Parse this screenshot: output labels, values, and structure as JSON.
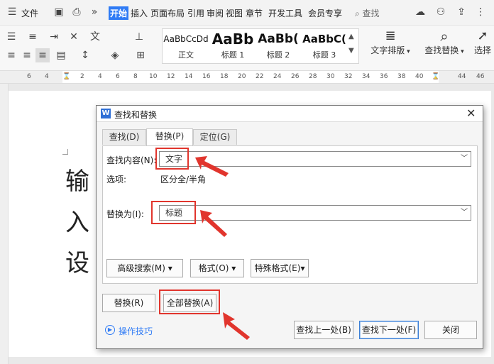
{
  "menubar": {
    "file": "文件",
    "items": [
      "开始",
      "插入",
      "页面布局",
      "引用",
      "审阅",
      "视图",
      "章节",
      "开发工具",
      "会员专享"
    ],
    "search": "查找"
  },
  "ribbon": {
    "styles": [
      {
        "sample": "AaBbCcDd",
        "name": "正文"
      },
      {
        "sample": "AaBb",
        "name": "标题 1"
      },
      {
        "sample": "AaBb(",
        "name": "标题 2"
      },
      {
        "sample": "AaBbC(",
        "name": "标题 3"
      }
    ],
    "text_layout": "文字排版",
    "find_replace": "查找替换",
    "select": "选择"
  },
  "ruler": {
    "ticks": [
      "6",
      "4",
      "2",
      "2",
      "4",
      "6",
      "8",
      "10",
      "12",
      "14",
      "16",
      "18",
      "20",
      "22",
      "24",
      "26",
      "28",
      "30",
      "32",
      "34",
      "36",
      "38",
      "40",
      "42",
      "44",
      "46"
    ]
  },
  "document": {
    "chars": [
      "输",
      "入",
      "设"
    ]
  },
  "dialog": {
    "title": "查找和替换",
    "tabs": [
      {
        "label": "查找(D)",
        "selected": false
      },
      {
        "label": "替换(P)",
        "selected": true
      },
      {
        "label": "定位(G)",
        "selected": false
      }
    ],
    "find_label": "查找内容(N):",
    "find_value": "文字",
    "options_label": "选项:",
    "options_value": "区分全/半角",
    "replace_label": "替换为(I):",
    "replace_value": "标题",
    "advanced_search": "高级搜索(M)",
    "format": "格式(O)",
    "special_format": "特殊格式(E)",
    "replace_button": "替换(R)",
    "replace_all_button": "全部替换(A)",
    "tips_link": "操作技巧",
    "find_prev": "查找上一处(B)",
    "find_next": "查找下一处(F)",
    "close": "关闭"
  },
  "colors": {
    "accent": "#2f7bf5",
    "highlight": "#e1352d"
  }
}
